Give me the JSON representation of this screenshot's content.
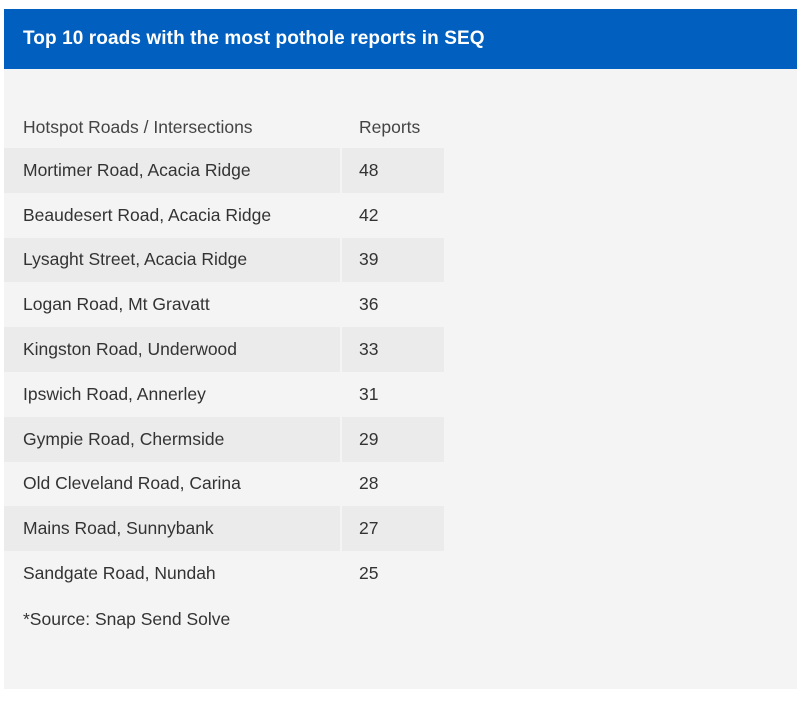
{
  "chart_data": {
    "type": "table",
    "title": "Top 10 roads with the most pothole reports in SEQ",
    "columns": [
      "Hotspot Roads / Intersections",
      "Reports"
    ],
    "rows": [
      {
        "road": "Mortimer Road, Acacia Ridge",
        "reports": 48
      },
      {
        "road": "Beaudesert Road, Acacia Ridge",
        "reports": 42
      },
      {
        "road": "Lysaght Street, Acacia Ridge",
        "reports": 39
      },
      {
        "road": "Logan Road, Mt Gravatt",
        "reports": 36
      },
      {
        "road": "Kingston Road, Underwood",
        "reports": 33
      },
      {
        "road": "Ipswich Road, Annerley",
        "reports": 31
      },
      {
        "road": "Gympie Road, Chermside",
        "reports": 29
      },
      {
        "road": "Old Cleveland Road, Carina",
        "reports": 28
      },
      {
        "road": "Mains Road, Sunnybank",
        "reports": 27
      },
      {
        "road": "Sandgate Road, Nundah",
        "reports": 25
      }
    ],
    "footnote": "*Source: Snap Send Solve"
  },
  "colors": {
    "header_bg": "#0160bf",
    "card_bg": "#f4f4f4",
    "row_shade": "#ebebeb"
  }
}
